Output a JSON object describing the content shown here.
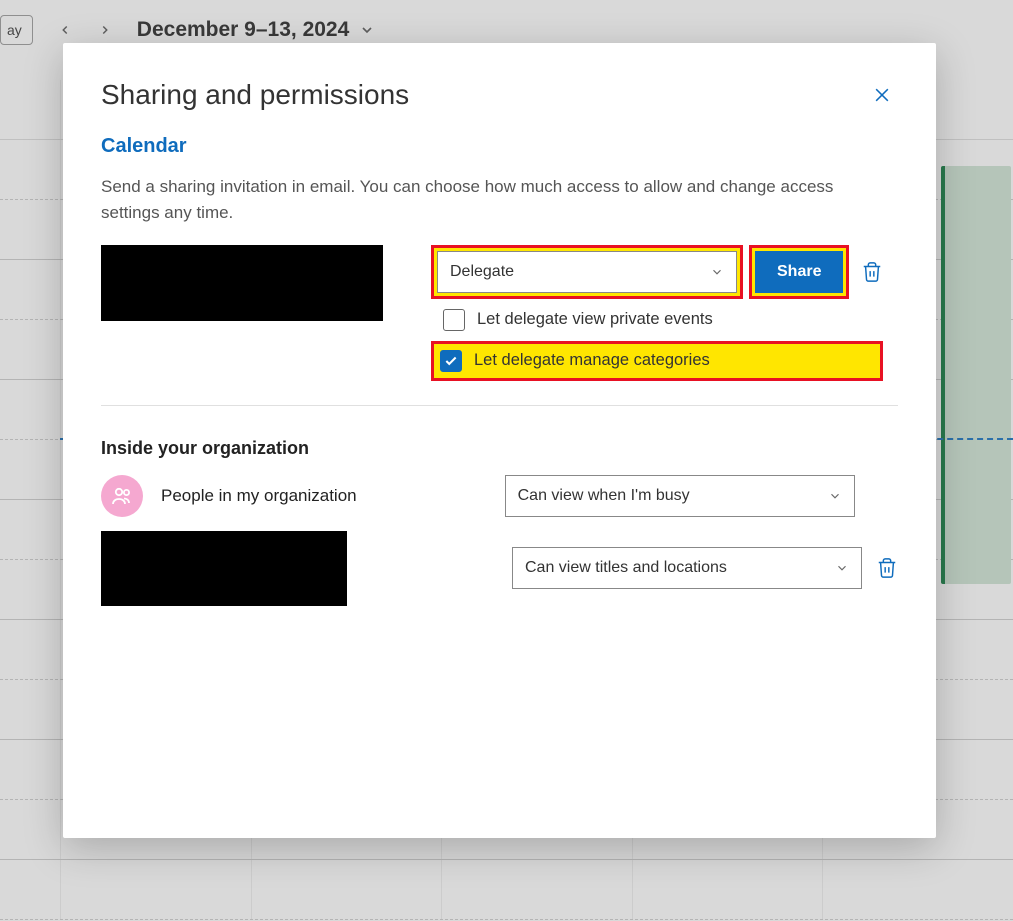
{
  "background": {
    "today_label": "ay",
    "date_range": "December 9–13, 2024",
    "day_fragment": "day"
  },
  "modal": {
    "title": "Sharing and permissions",
    "section": "Calendar",
    "description": "Send a sharing invitation in email. You can choose how much access to allow and change access settings any time.",
    "permission_select": "Delegate",
    "share_button": "Share",
    "checkbox_private": "Let delegate view private events",
    "checkbox_categories": "Let delegate manage categories",
    "org_heading": "Inside your organization",
    "org_people_label": "People in my organization",
    "org_people_permission": "Can view when I'm busy",
    "org_user_permission": "Can view titles and locations"
  }
}
